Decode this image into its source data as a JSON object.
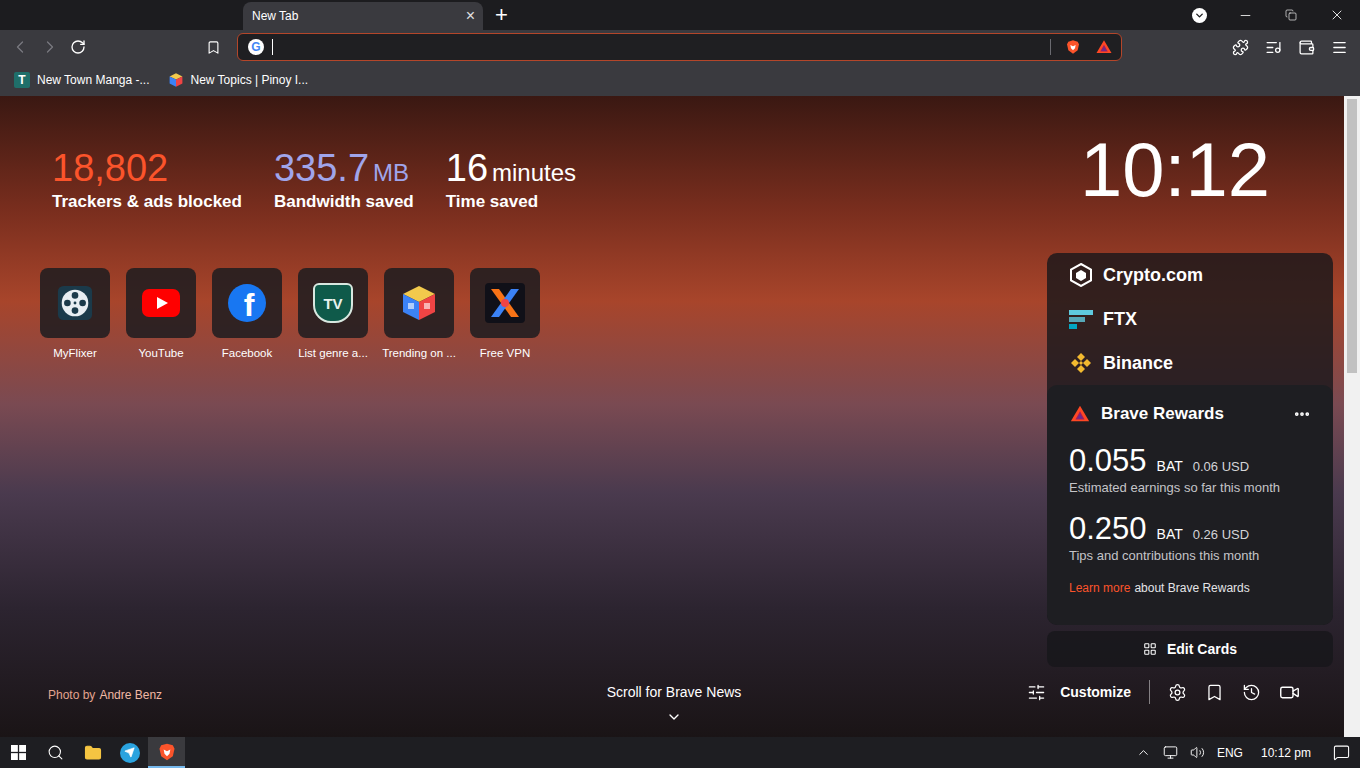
{
  "tabs": [
    {
      "label": "New Tab",
      "selected": true
    }
  ],
  "tab_close": "×",
  "new_tab": "+",
  "nav": {
    "back_disabled": true,
    "forward_disabled": true
  },
  "address_bar": {
    "value": "",
    "search_icon_text": "G"
  },
  "bookmarks": [
    {
      "label": "New Town Manga -...",
      "kind": "letter",
      "icon_text": "T"
    },
    {
      "label": "New Topics | Pinoy I...",
      "kind": "cube",
      "icon_text": ""
    }
  ],
  "stats": [
    {
      "value": "18,802",
      "unit": "",
      "label": "Trackers & ads blocked",
      "color": "#fb542b"
    },
    {
      "value": "335.7",
      "unit": "MB",
      "label": "Bandwidth saved",
      "color": "#a0a5eb"
    },
    {
      "value": "16",
      "unit": "minutes",
      "label": "Time saved",
      "color": "#ffffff"
    }
  ],
  "top_sites": [
    {
      "label": "MyFlixer",
      "kind": "film",
      "icon_text": ""
    },
    {
      "label": "YouTube",
      "kind": "youtube",
      "icon_text": ""
    },
    {
      "label": "Facebook",
      "kind": "facebook",
      "icon_text": "f"
    },
    {
      "label": "List genre a...",
      "kind": "tv",
      "icon_text": "TV"
    },
    {
      "label": "Trending on ...",
      "kind": "cube",
      "icon_text": ""
    },
    {
      "label": "Free VPN",
      "kind": "vpn",
      "icon_text": ""
    }
  ],
  "clock": "10:12",
  "cards": [
    {
      "label": "Crypto.com",
      "kind": "cryptocom"
    },
    {
      "label": "FTX",
      "kind": "ftx"
    },
    {
      "label": "Binance",
      "kind": "binance"
    }
  ],
  "rewards": {
    "title": "Brave Rewards",
    "rows": [
      {
        "amount": "0.055",
        "currency": "BAT",
        "usd": "0.06 USD",
        "caption": "Estimated earnings so far this month"
      },
      {
        "amount": "0.250",
        "currency": "BAT",
        "usd": "0.26 USD",
        "caption": "Tips and contributions this month"
      }
    ],
    "learn_more": {
      "link": "Learn more",
      "text": "about Brave Rewards"
    }
  },
  "edit_cards": "Edit Cards",
  "photo_credit": {
    "prefix": "Photo by",
    "author": "Andre Benz"
  },
  "news": "Scroll for Brave News",
  "customize": "Customize",
  "scrollbar": {
    "level": 0.43
  },
  "taskbar": {
    "apps": [
      {
        "kind": "search",
        "active": false
      },
      {
        "kind": "folder",
        "active": false
      },
      {
        "kind": "telegram",
        "active": false
      },
      {
        "kind": "brave",
        "active": true
      }
    ],
    "language": "ENG",
    "time": "10:12 pm"
  }
}
